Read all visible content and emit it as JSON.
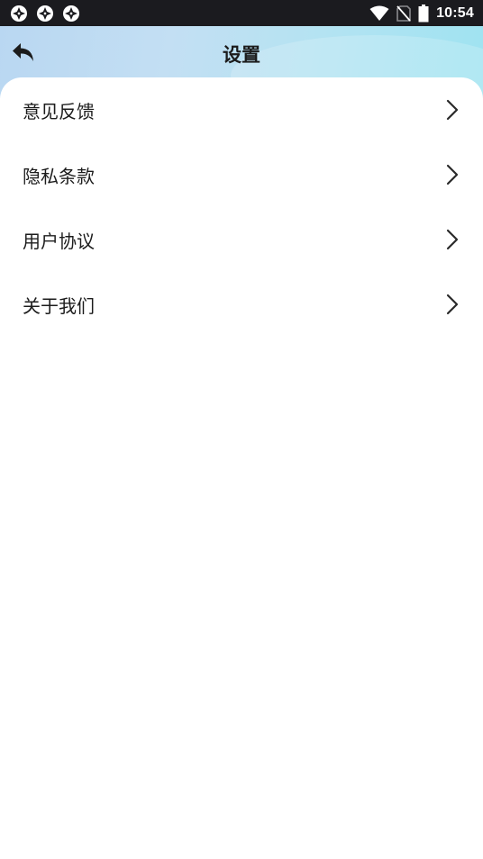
{
  "status_bar": {
    "time": "10:54",
    "app_icons": [
      "app-notification-icon",
      "app-notification-icon",
      "app-notification-icon"
    ],
    "system_icons": [
      "wifi-icon",
      "no-sim-icon",
      "battery-icon"
    ]
  },
  "header": {
    "title": "设置",
    "back_icon": "back-arrow-icon",
    "gradient_colors": [
      "#b9d7f2",
      "#9fe3f1"
    ]
  },
  "menu": {
    "items": [
      {
        "label": "意见反馈",
        "icon": "chevron-right-icon"
      },
      {
        "label": "隐私条款",
        "icon": "chevron-right-icon"
      },
      {
        "label": "用户协议",
        "icon": "chevron-right-icon"
      },
      {
        "label": "关于我们",
        "icon": "chevron-right-icon"
      }
    ]
  }
}
